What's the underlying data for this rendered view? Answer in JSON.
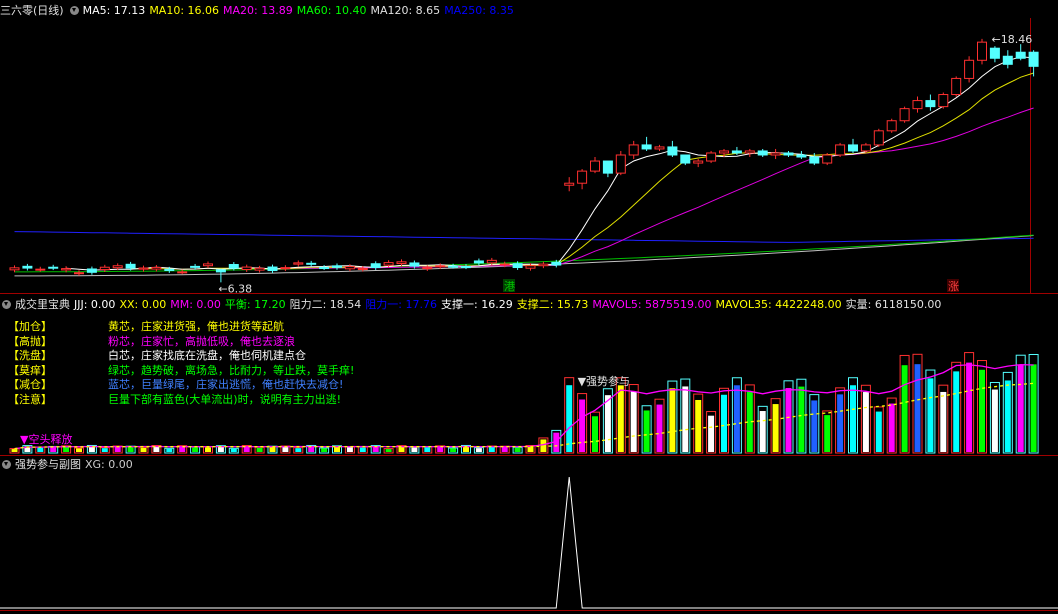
{
  "main_header": {
    "title": "三六零(日线)",
    "items": [
      {
        "label": "MA5: 17.13",
        "color": "#ffffff"
      },
      {
        "label": "MA10: 16.06",
        "color": "#ffff00"
      },
      {
        "label": "MA20: 13.89",
        "color": "#ff00ff"
      },
      {
        "label": "MA60: 10.40",
        "color": "#00ff00"
      },
      {
        "label": "MA120: 8.65",
        "color": "#e0e0e0"
      },
      {
        "label": "MA250: 8.35",
        "color": "#0000ff"
      }
    ]
  },
  "main_chart": {
    "high_label": "18.46",
    "low_label": "6.38",
    "markers": [
      {
        "text": "港",
        "color": "#00c000"
      },
      {
        "text": "涨",
        "color": "#ff4040"
      }
    ],
    "candles_tail": [
      [
        11.2,
        11.6,
        10.9,
        11.3
      ],
      [
        11.3,
        12.0,
        11.0,
        11.9
      ],
      [
        11.9,
        12.6,
        11.8,
        12.4
      ],
      [
        12.4,
        12.4,
        11.6,
        11.8
      ],
      [
        11.8,
        12.9,
        11.7,
        12.7
      ],
      [
        12.7,
        13.4,
        12.5,
        13.2
      ],
      [
        13.2,
        13.6,
        12.9,
        13.0
      ],
      [
        13.0,
        13.2,
        12.9,
        13.1
      ],
      [
        13.1,
        13.4,
        12.6,
        12.7
      ],
      [
        12.7,
        12.7,
        12.2,
        12.3
      ],
      [
        12.3,
        12.5,
        12.1,
        12.4
      ],
      [
        12.4,
        12.9,
        12.3,
        12.8
      ],
      [
        12.8,
        13.0,
        12.6,
        12.9
      ],
      [
        12.9,
        13.1,
        12.7,
        12.8
      ],
      [
        12.8,
        13.0,
        12.6,
        12.9
      ],
      [
        12.9,
        13.0,
        12.6,
        12.7
      ],
      [
        12.7,
        13.0,
        12.5,
        12.8
      ],
      [
        12.8,
        12.9,
        12.6,
        12.7
      ],
      [
        12.7,
        12.9,
        12.5,
        12.6
      ],
      [
        12.6,
        12.8,
        12.2,
        12.3
      ],
      [
        12.3,
        12.8,
        12.2,
        12.7
      ],
      [
        12.7,
        13.3,
        12.6,
        13.2
      ],
      [
        13.2,
        13.5,
        12.8,
        12.9
      ],
      [
        12.9,
        13.3,
        12.8,
        13.2
      ],
      [
        13.2,
        14.0,
        13.1,
        13.9
      ],
      [
        13.9,
        14.5,
        13.8,
        14.4
      ],
      [
        14.4,
        15.1,
        14.3,
        15.0
      ],
      [
        15.0,
        15.6,
        14.8,
        15.4
      ],
      [
        15.4,
        15.7,
        14.9,
        15.1
      ],
      [
        15.1,
        15.8,
        15.0,
        15.7
      ],
      [
        15.7,
        16.6,
        15.6,
        16.5
      ],
      [
        16.5,
        17.6,
        16.3,
        17.4
      ],
      [
        17.4,
        18.46,
        17.2,
        18.3
      ],
      [
        18.0,
        18.1,
        17.3,
        17.5
      ],
      [
        17.6,
        17.9,
        17.0,
        17.2
      ],
      [
        17.8,
        18.2,
        17.4,
        17.5
      ],
      [
        17.8,
        17.9,
        16.6,
        17.1
      ]
    ]
  },
  "sub1_header": {
    "title": "成交里宝典",
    "items": [
      {
        "label": "JJJ: 0.00",
        "color": "#ffffff"
      },
      {
        "label": "XX: 0.00",
        "color": "#ffff00"
      },
      {
        "label": "MM: 0.00",
        "color": "#ff00ff"
      },
      {
        "label": "平衡: 17.20",
        "color": "#00ff00"
      },
      {
        "label": "阻力二: 18.54",
        "color": "#e0e0e0"
      },
      {
        "label": "阻力一: 17.76",
        "color": "#0000ff"
      },
      {
        "label": "支撑一: 16.29",
        "color": "#ffffff"
      },
      {
        "label": "支撑二: 15.73",
        "color": "#ffff00"
      },
      {
        "label": "MAVOL5: 5875519.00",
        "color": "#ff00ff"
      },
      {
        "label": "MAVOL35: 4422248.00",
        "color": "#ffff00"
      },
      {
        "label": "实量: 6118150.00",
        "color": "#e0e0e0"
      }
    ]
  },
  "legend": [
    {
      "label": "【加仓】",
      "text": "黄芯，庄家进货强，俺也进货等起航",
      "color": "#ffff00"
    },
    {
      "label": "【高抛】",
      "text": "粉芯，庄家忙，高抛低吸，俺也去逐浪",
      "color": "#ff00ff"
    },
    {
      "label": "【洗盘】",
      "text": "白芯，庄家找底在洗盘，俺也伺机建点仓",
      "color": "#ffffff"
    },
    {
      "label": "【莫痒】",
      "text": "绿芯，趋势破，离场急，比耐力，等止跌，莫手痒!",
      "color": "#00ff00"
    },
    {
      "label": "【减仓】",
      "text": "蓝芯，巨量绿尾，庄家出逃慌，俺也赶快去减仓!",
      "color": "#4080ff"
    },
    {
      "label": "【注意】",
      "text": "巨量下部有蓝色(大单流出)时，说明有主力出逃!",
      "color": "#00ff00"
    }
  ],
  "sub1_chart": {
    "marker_strong": "▼强势参与",
    "marker_empty": "▼空头释放"
  },
  "sub2_header": {
    "title": "强势参与副图",
    "items": [
      {
        "label": "XG: 0.00",
        "color": "#cccccc"
      }
    ]
  }
}
